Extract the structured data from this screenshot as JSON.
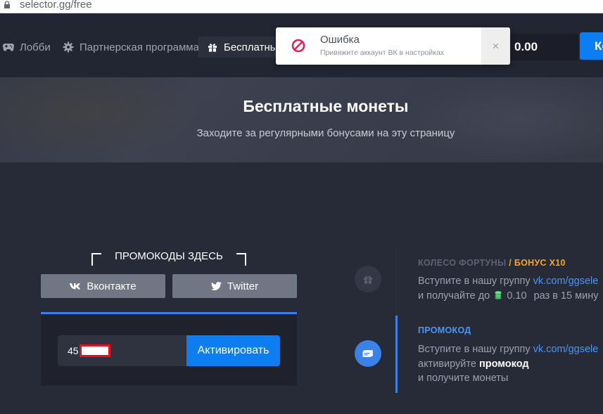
{
  "browser": {
    "url": "selector.gg/free"
  },
  "nav": {
    "items": [
      {
        "label": "Лобби",
        "icon": "gamepad-icon"
      },
      {
        "label": "Партнерская программа",
        "icon": "gear-icon"
      },
      {
        "label": "Бесплатные",
        "icon": "gift-icon"
      }
    ],
    "balance": "0.00",
    "login_label": "Ко"
  },
  "toast": {
    "title": "Ошибка",
    "message": "Привяжите аккаунт ВК в настройках",
    "close": "×",
    "icon": "error-icon"
  },
  "hero": {
    "title": "Бесплатные монеты",
    "subtitle": "Заходите за регулярными бонусами на эту страницу"
  },
  "promo": {
    "heading": "ПРОМОКОДЫ ЗДЕСЬ",
    "vk_label": "Вконтакте",
    "twitter_label": "Twitter",
    "input_value": "45",
    "activate_label": "Активировать"
  },
  "wheel": {
    "title": "КОЛЕСО ФОРТУНЫ",
    "bonus": "/ БОНУС X10",
    "line1_prefix": "Вступите в нашу группу",
    "line1_link": "vk.com/ggsele",
    "line2_prefix": "и получайте до",
    "line2_amount": "0.10",
    "line2_suffix": "раз в 15 мину"
  },
  "promocode": {
    "title": "ПРОМОКОД",
    "line1_prefix": "Вступите в нашу группу",
    "line1_link": "vk.com/ggsele",
    "line2_prefix": "активируйте",
    "line2_strong": "промокод",
    "line3": "и получите монеты"
  },
  "colors": {
    "accent": "#0d7ef2",
    "timeline_active": "#3b82e8",
    "bonus": "#f5a623",
    "error": "#e0245e"
  }
}
